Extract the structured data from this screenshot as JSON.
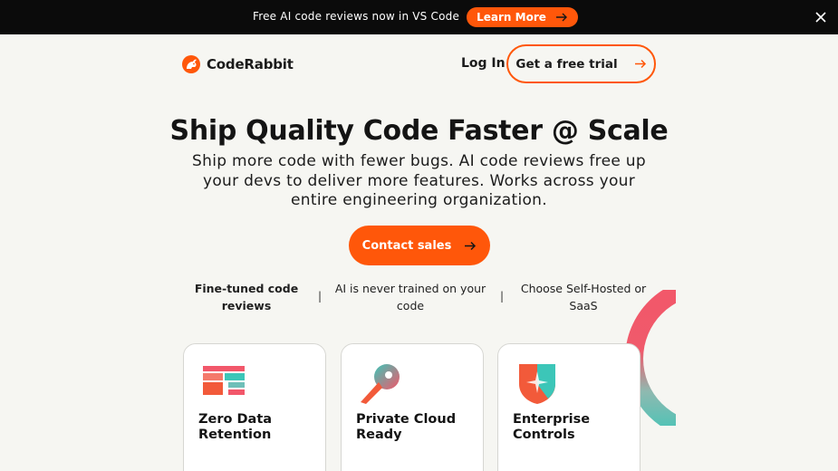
{
  "banner": {
    "text": "Free AI code reviews now in VS Code",
    "button_label": "Learn More",
    "close_icon": "close-icon"
  },
  "nav": {
    "logo_text": "CodeRabbit",
    "login_label": "Log In",
    "trial_label": "Get a free trial"
  },
  "hero": {
    "title": "Ship Quality Code Faster @ Scale",
    "subtitle": "Ship more code with fewer bugs. AI code reviews free up your devs to deliver more features. Works across your entire engineering organization.",
    "cta_label": "Contact sales"
  },
  "features": [
    {
      "label": "Fine-tuned code reviews"
    },
    {
      "label": "AI is never trained on your code"
    },
    {
      "label": "Choose Self-Hosted or SaaS"
    }
  ],
  "separator": "|",
  "cards": [
    {
      "title": "Zero Data Retention",
      "icon": "zero-data-icon"
    },
    {
      "title": "Private Cloud Ready",
      "icon": "cloud-key-icon"
    },
    {
      "title": "Enterprise Controls",
      "icon": "shield-icon"
    }
  ],
  "colors": {
    "accent": "#ff570a",
    "banner_bg": "#0b0b0b",
    "page_bg": "#f6f6f2",
    "teal": "#3cc6b8",
    "pink": "#f2576a"
  }
}
